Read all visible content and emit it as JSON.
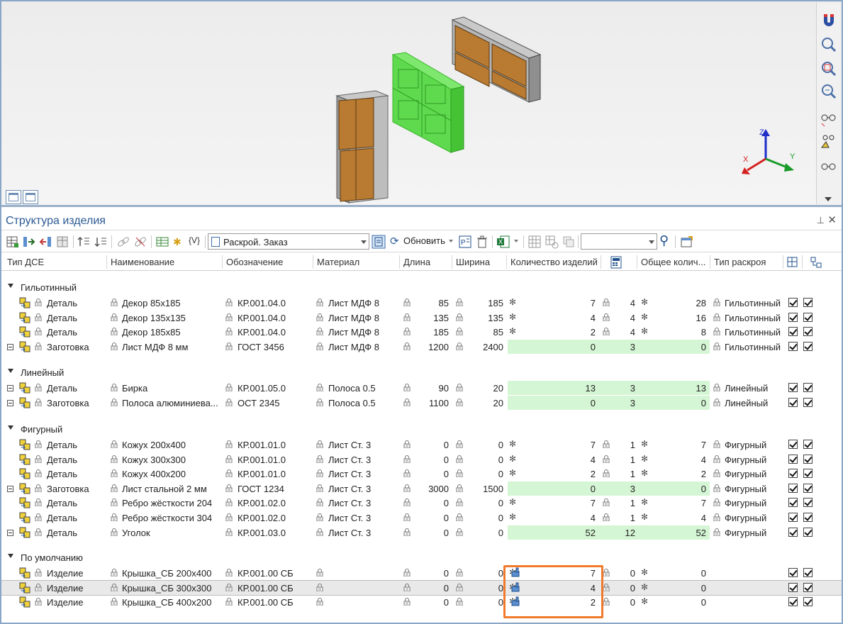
{
  "panel": {
    "title": "Структура изделия",
    "pin": "⊥",
    "close": "✕"
  },
  "toolbar": {
    "view_select": "Раскрой. Заказ",
    "refresh_label": "Обновить",
    "var_label": "{V}",
    "search_value": ""
  },
  "columns": [
    "Тип ДСЕ",
    "Наименование",
    "Обозначение",
    "Материал",
    "Длина",
    "Ширина",
    "Количество изделий",
    "Общее колич...",
    "Тип раскроя"
  ],
  "axis": {
    "x": "X",
    "y": "Y",
    "z": "Z"
  },
  "groups": [
    {
      "title": "Гильотинный",
      "rows": [
        {
          "type": "Деталь",
          "name": "Декор 85х185",
          "code": "КР.001.04.0",
          "material": "Лист МДФ 8",
          "length": "85",
          "width": "185",
          "qty": "7",
          "n": "4",
          "total": "28",
          "cut": "Гильотинный",
          "expand": false,
          "green": false,
          "gear": true
        },
        {
          "type": "Деталь",
          "name": "Декор 135х135",
          "code": "КР.001.04.0",
          "material": "Лист МДФ 8",
          "length": "135",
          "width": "135",
          "qty": "4",
          "n": "4",
          "total": "16",
          "cut": "Гильотинный",
          "expand": false,
          "green": false,
          "gear": true
        },
        {
          "type": "Деталь",
          "name": "Декор 185х85",
          "code": "КР.001.04.0",
          "material": "Лист МДФ 8",
          "length": "185",
          "width": "85",
          "qty": "2",
          "n": "4",
          "total": "8",
          "cut": "Гильотинный",
          "expand": false,
          "green": false,
          "gear": true
        },
        {
          "type": "Заготовка",
          "name": "Лист МДФ 8 мм",
          "code": "ГОСТ 3456",
          "material": "Лист МДФ 8",
          "length": "1200",
          "width": "2400",
          "qty": "0",
          "n": "3",
          "total": "0",
          "cut": "Гильотинный",
          "expand": true,
          "green": true,
          "gear": false
        }
      ]
    },
    {
      "title": "Линейный",
      "rows": [
        {
          "type": "Деталь",
          "name": "Бирка",
          "code": "КР.001.05.0",
          "material": "Полоса 0.5",
          "length": "90",
          "width": "20",
          "qty": "13",
          "n": "3",
          "total": "13",
          "cut": "Линейный",
          "expand": true,
          "green": true,
          "gear": false
        },
        {
          "type": "Заготовка",
          "name": "Полоса алюминиева...",
          "code": "ОСТ 2345",
          "material": "Полоса 0.5",
          "length": "1100",
          "width": "20",
          "qty": "0",
          "n": "3",
          "total": "0",
          "cut": "Линейный",
          "expand": true,
          "green": true,
          "gear": false
        }
      ]
    },
    {
      "title": "Фигурный",
      "rows": [
        {
          "type": "Деталь",
          "name": "Кожух 200х400",
          "code": "КР.001.01.0",
          "material": "Лист Ст. 3",
          "length": "0",
          "width": "0",
          "qty": "7",
          "n": "1",
          "total": "7",
          "cut": "Фигурный",
          "expand": false,
          "green": false,
          "gear": true
        },
        {
          "type": "Деталь",
          "name": "Кожух 300х300",
          "code": "КР.001.01.0",
          "material": "Лист Ст. 3",
          "length": "0",
          "width": "0",
          "qty": "4",
          "n": "1",
          "total": "4",
          "cut": "Фигурный",
          "expand": false,
          "green": false,
          "gear": true
        },
        {
          "type": "Деталь",
          "name": "Кожух 400х200",
          "code": "КР.001.01.0",
          "material": "Лист Ст. 3",
          "length": "0",
          "width": "0",
          "qty": "2",
          "n": "1",
          "total": "2",
          "cut": "Фигурный",
          "expand": false,
          "green": false,
          "gear": true
        },
        {
          "type": "Заготовка",
          "name": "Лист стальной 2 мм",
          "code": "ГОСТ 1234",
          "material": "Лист Ст. 3",
          "length": "3000",
          "width": "1500",
          "qty": "0",
          "n": "3",
          "total": "0",
          "cut": "Фигурный",
          "expand": true,
          "green": true,
          "gear": false
        },
        {
          "type": "Деталь",
          "name": "Ребро жёсткости 204",
          "code": "КР.001.02.0",
          "material": "Лист Ст. 3",
          "length": "0",
          "width": "0",
          "qty": "7",
          "n": "1",
          "total": "7",
          "cut": "Фигурный",
          "expand": false,
          "green": false,
          "gear": true
        },
        {
          "type": "Деталь",
          "name": "Ребро жёсткости 304",
          "code": "КР.001.02.0",
          "material": "Лист Ст. 3",
          "length": "0",
          "width": "0",
          "qty": "4",
          "n": "1",
          "total": "4",
          "cut": "Фигурный",
          "expand": false,
          "green": false,
          "gear": true
        },
        {
          "type": "Деталь",
          "name": "Уголок",
          "code": "КР.001.03.0",
          "material": "Лист Ст. 3",
          "length": "0",
          "width": "0",
          "qty": "52",
          "n": "12",
          "total": "52",
          "cut": "Фигурный",
          "expand": true,
          "green": true,
          "gear": false
        }
      ]
    },
    {
      "title": "По умолчанию",
      "rows": [
        {
          "type": "Изделие",
          "name": "Крышка_СБ 200х400",
          "code": "КР.001.00 СБ",
          "material": "",
          "length": "0",
          "width": "0",
          "qty": "7",
          "n": "0",
          "total": "0",
          "cut": "",
          "expand": false,
          "green": false,
          "gear": true,
          "hand": true
        },
        {
          "type": "Изделие",
          "name": "Крышка_СБ 300х300",
          "code": "КР.001.00 СБ",
          "material": "",
          "length": "0",
          "width": "0",
          "qty": "4",
          "n": "0",
          "total": "0",
          "cut": "",
          "expand": false,
          "green": false,
          "gear": true,
          "hand": true,
          "selected": true
        },
        {
          "type": "Изделие",
          "name": "Крышка_СБ 400х200",
          "code": "КР.001.00 СБ",
          "material": "",
          "length": "0",
          "width": "0",
          "qty": "2",
          "n": "0",
          "total": "0",
          "cut": "",
          "expand": false,
          "green": false,
          "gear": true,
          "hand": true
        }
      ]
    }
  ],
  "colors": {
    "accent": "#2c5a93",
    "highlight_green": "#d5f6d4",
    "annotation": "#f07a2a",
    "selected_model": "#63e04f"
  }
}
